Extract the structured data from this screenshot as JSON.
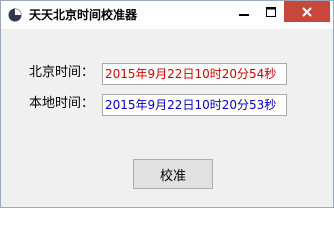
{
  "window": {
    "title": "天天北京时间校准器",
    "icons": {
      "app": "clock-icon",
      "minimize": "minimize-icon",
      "maximize": "maximize-icon",
      "close": "close-icon"
    }
  },
  "beijing": {
    "label": "北京时间：",
    "value": "2015年9月22日10时20分54秒",
    "color": "#d00000"
  },
  "local": {
    "label": "本地时间：",
    "value": "2015年9月22日10时20分53秒",
    "color": "#0000c0"
  },
  "calibrate_button": {
    "label": "校准"
  }
}
